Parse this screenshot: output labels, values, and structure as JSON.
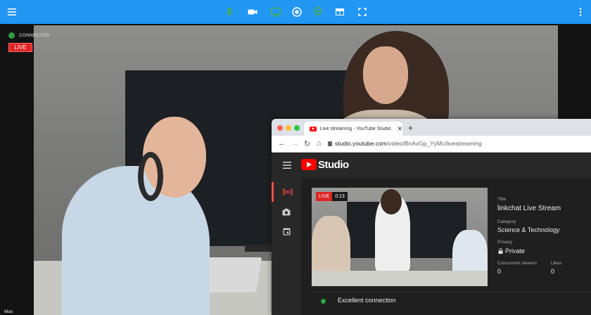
{
  "toolbar": {
    "menu_icon": "hamburger-menu-icon",
    "items": [
      {
        "icon": "microphone-icon",
        "color": "#4caf50"
      },
      {
        "icon": "camera-icon",
        "color": "#ffffff"
      },
      {
        "icon": "monitor-icon",
        "color": "#4caf50"
      },
      {
        "icon": "record-icon",
        "color": "#ffffff"
      },
      {
        "icon": "broadcast-icon",
        "color": "#4caf50"
      },
      {
        "icon": "layout-icon",
        "color": "#ffffff"
      },
      {
        "icon": "fullscreen-icon",
        "color": "#ffffff"
      }
    ],
    "more_icon": "more-vertical-icon",
    "background": "#2196f3"
  },
  "stream": {
    "connection_status": "CONNECTED",
    "connection_color": "#2e9e3e",
    "live_label": "LIVE",
    "participant_name": "Max"
  },
  "browser": {
    "tab_title": "Live streaming - YouTube Studio",
    "url_host": "studio.youtube.com",
    "url_path": "/video/BnAvGp_YyMc/livestreaming",
    "window_dots": [
      "#ff5f57",
      "#febc2e",
      "#28c840"
    ]
  },
  "studio": {
    "logo_text": "Studio",
    "sidebar": [
      {
        "icon": "live-broadcast-icon",
        "active": true
      },
      {
        "icon": "camera-icon",
        "active": false
      },
      {
        "icon": "calendar-icon",
        "active": false
      }
    ],
    "preview": {
      "live_label": "LIVE",
      "elapsed": "0:13"
    },
    "details": {
      "title_label": "Title",
      "title_value": "linkchat Live Stream",
      "category_label": "Category",
      "category_value": "Science & Technology",
      "privacy_label": "Privacy",
      "privacy_value": "Private",
      "viewers_label": "Concurrent viewers",
      "viewers_value": "0",
      "likes_label": "Likes",
      "likes_value": "0"
    },
    "connection": {
      "status_text": "Excellent connection",
      "color": "#2ba640"
    }
  }
}
